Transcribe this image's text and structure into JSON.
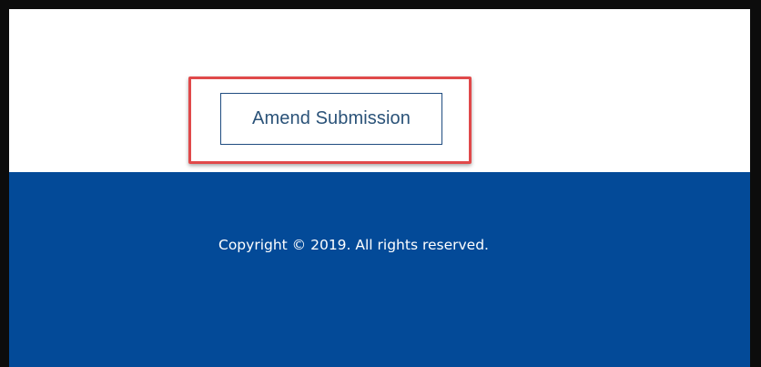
{
  "main": {
    "amend_button_label": "Amend Submission"
  },
  "footer": {
    "copyright_text": "Copyright © 2019. All rights reserved."
  },
  "colors": {
    "footer_background": "#034a98",
    "button_border": "#1f4c80",
    "highlight_outline": "#e0494a"
  }
}
